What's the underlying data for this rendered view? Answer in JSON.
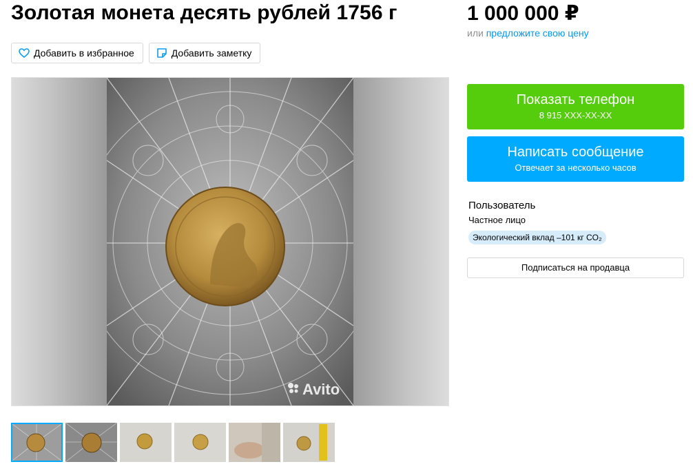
{
  "listing": {
    "title": "Золотая монета десять рублей 1756 г",
    "price": "1 000 000 ₽",
    "price_sub_prefix": "или ",
    "price_sub_link": "предложите свою цену"
  },
  "actions": {
    "favorite_label": "Добавить в избранное",
    "note_label": "Добавить заметку"
  },
  "gallery": {
    "watermark": "Avito",
    "thumbnails": [
      {
        "name": "thumb-1",
        "active": true
      },
      {
        "name": "thumb-2",
        "active": false
      },
      {
        "name": "thumb-3",
        "active": false
      },
      {
        "name": "thumb-4",
        "active": false
      },
      {
        "name": "thumb-5",
        "active": false
      },
      {
        "name": "thumb-6",
        "active": false
      }
    ]
  },
  "contact": {
    "show_phone_label": "Показать телефон",
    "phone_masked": "8 915 XXX-XX-XX",
    "message_label": "Написать сообщение",
    "message_sub": "Отвечает за несколько часов"
  },
  "seller": {
    "name": "Пользователь",
    "type": "Частное лицо",
    "eco_badge": "Экологический вклад –101 кг CO₂",
    "subscribe_label": "Подписаться на продавца"
  },
  "colors": {
    "green": "#55cc0c",
    "blue": "#00aaff",
    "link": "#0099f7",
    "badge_bg": "#d6ecfb"
  },
  "icons": [
    "heart-icon",
    "note-icon",
    "avito-logo-icon"
  ]
}
